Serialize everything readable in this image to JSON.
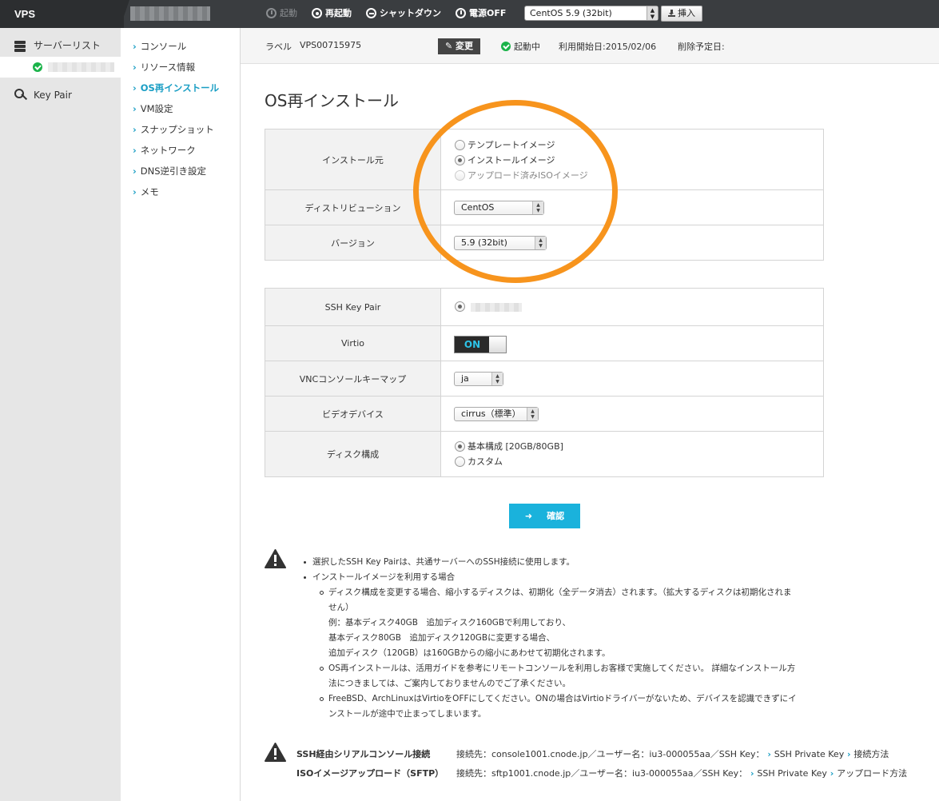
{
  "brand": "VPS",
  "toolbar": {
    "start": "起動",
    "restart": "再起動",
    "shutdown": "シャットダウン",
    "power_off": "電源OFF",
    "os_image": "CentOS 5.9 (32bit)",
    "insert": "挿入"
  },
  "sidebar": {
    "server_list": "サーバーリスト",
    "key_pair": "Key Pair"
  },
  "submenu": [
    "コンソール",
    "リソース情報",
    "OS再インストール",
    "VM設定",
    "スナップショット",
    "ネットワーク",
    "DNS逆引き設定",
    "メモ"
  ],
  "infobar": {
    "label_key": "ラベル",
    "label_value": "VPS00715975",
    "edit": "変更",
    "status": "起動中",
    "start_date": "利用開始日:2015/02/06",
    "delete_date": "削除予定日:"
  },
  "page_title": "OS再インストール",
  "install": {
    "source_label": "インストール元",
    "source_options": [
      "テンプレートイメージ",
      "インストールイメージ",
      "アップロード済みISOイメージ"
    ],
    "source_selected": 1,
    "distro_label": "ディストリビューション",
    "distro_value": "CentOS",
    "version_label": "バージョン",
    "version_value": "5.9 (32bit)"
  },
  "settings": {
    "ssh_label": "SSH Key Pair",
    "virtio_label": "Virtio",
    "virtio_value": "ON",
    "vnc_label": "VNCコンソールキーマップ",
    "vnc_value": "ja",
    "video_label": "ビデオデバイス",
    "video_value": "cirrus（標準）",
    "disk_label": "ディスク構成",
    "disk_options": [
      "基本構成 [20GB/80GB]",
      "カスタム"
    ],
    "disk_selected": 0
  },
  "confirm": "確認",
  "notes": {
    "b1": "選択したSSH Key Pairは、共通サーバーへのSSH接続に使用します。",
    "b2": "インストールイメージを利用する場合",
    "s1_l1": "ディスク構成を変更する場合、縮小するディスクは、初期化（全データ消去）されます。（拡大するディスクは初期化されま",
    "s1_l2": "せん）",
    "s1_l3": "例：基本ディスク40GB　追加ディスク160GBで利用しており、",
    "s1_l4": "基本ディスク80GB　追加ディスク120GBに変更する場合、",
    "s1_l5": "追加ディスク（120GB）は160GBからの縮小にあわせて初期化されます。",
    "s2_l1": "OS再インストールは、活用ガイドを参考にリモートコンソールを利用しお客様で実施してください。 詳細なインストール方",
    "s2_l2": "法につきましては、ご案内しておりませんのでご了承ください。",
    "s3_l1": "FreeBSD、ArchLinuxはVirtioをOFFにしてください。ONの場合はVirtioドライバーがないため、デバイスを認識できずにイ",
    "s3_l2": "ンストールが途中で止まってしまいます。"
  },
  "ssh_serial": {
    "label": "SSH経由シリアルコンソール接続",
    "dest": "接続先：console1001.cnode.jp／ユーザー名：iu3-000055aa／SSH Key：",
    "key_link": "SSH Private Key",
    "how_link": "接続方法"
  },
  "iso_upload": {
    "label": "ISOイメージアップロード（SFTP）",
    "dest": "接続先：sftp1001.cnode.jp／ユーザー名：iu3-000055aa／SSH Key：",
    "key_link": "SSH Private Key",
    "how_link": "アップロード方法"
  },
  "colors": {
    "accent": "#1ab2dc",
    "highlight_circle": "#f7941d",
    "status_ok": "#1bb34a",
    "topbar": "#3a3d40"
  }
}
